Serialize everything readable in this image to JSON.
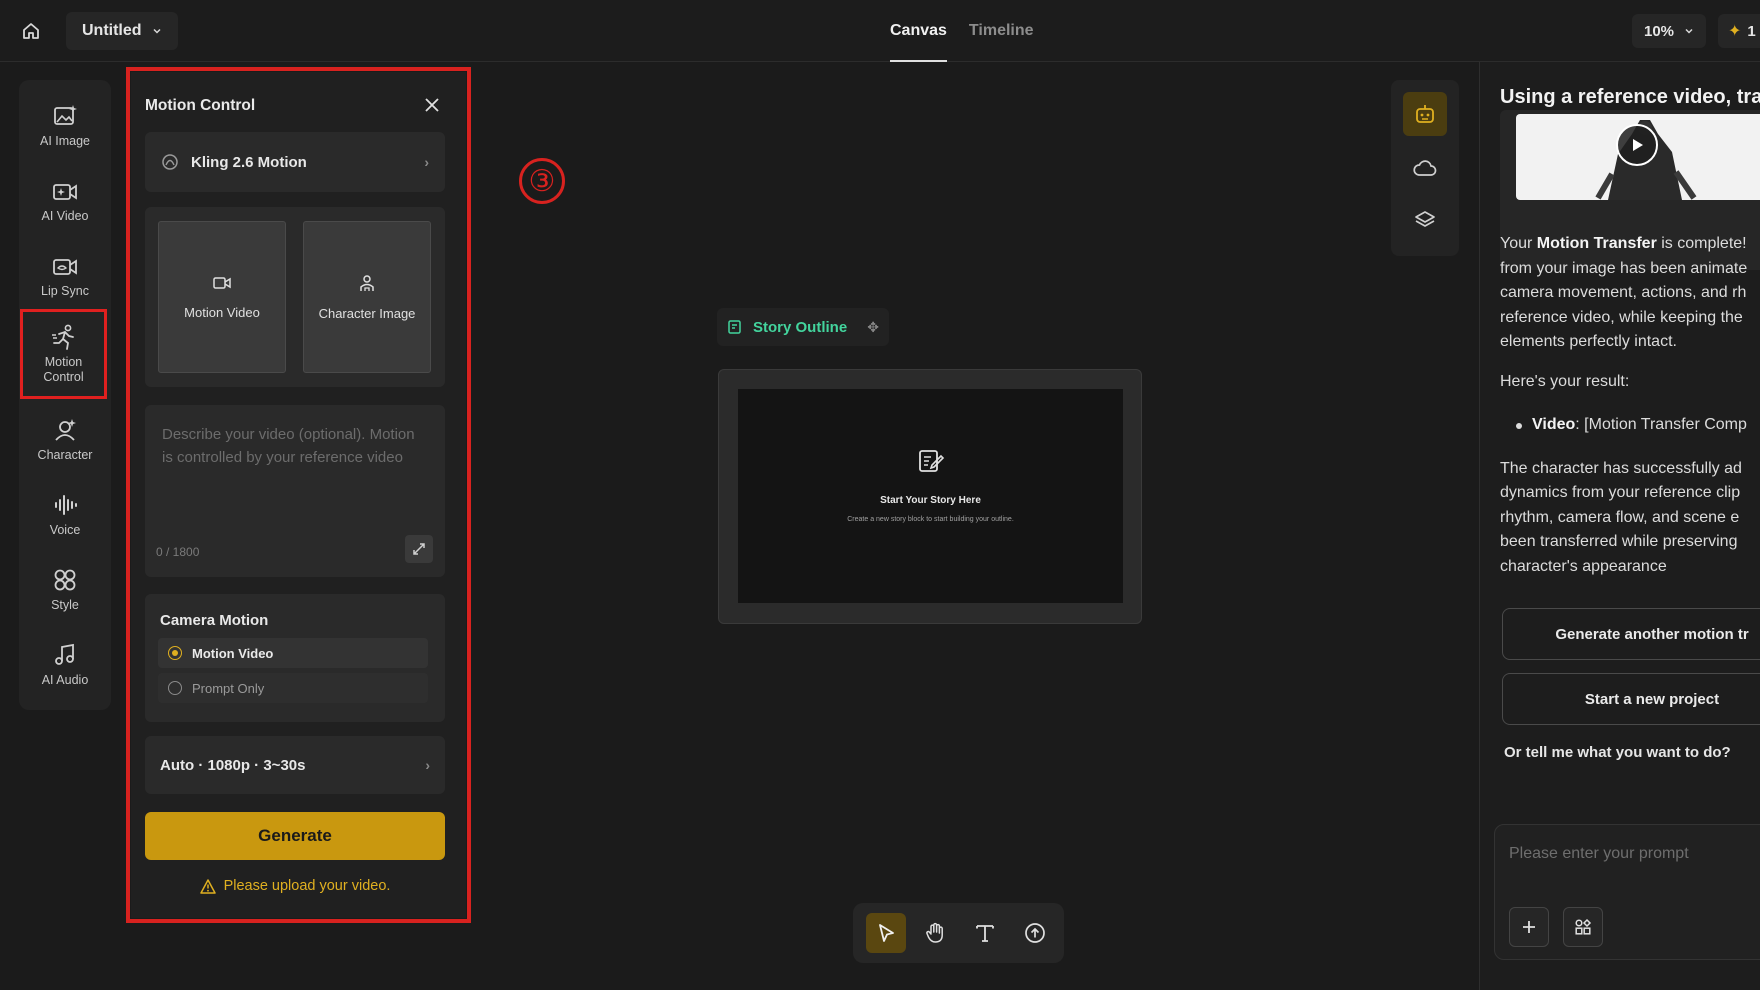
{
  "topbar": {
    "title": "Untitled",
    "tabs": [
      "Canvas",
      "Timeline"
    ],
    "zoom": "10%",
    "credits": "1"
  },
  "left_tools": [
    {
      "label": "AI Image",
      "icon": "image-sparkle-icon"
    },
    {
      "label": "AI Video",
      "icon": "video-sparkle-icon"
    },
    {
      "label": "Lip Sync",
      "icon": "lip-sync-icon"
    },
    {
      "label": "Motion Control",
      "icon": "running-figure-icon",
      "selected": true
    },
    {
      "label": "Character",
      "icon": "character-icon"
    },
    {
      "label": "Voice",
      "icon": "waveform-icon"
    },
    {
      "label": "Style",
      "icon": "style-grid-icon"
    },
    {
      "label": "AI Audio",
      "icon": "music-note-icon"
    }
  ],
  "motion_panel": {
    "title": "Motion Control",
    "model": "Kling 2.6 Motion",
    "upload_video_label": "Motion Video",
    "upload_character_label": "Character Image",
    "prompt_placeholder": "Describe your video (optional). Motion is controlled by your reference video",
    "prompt_count": "0 / 1800",
    "camera_motion_title": "Camera Motion",
    "camera_options": [
      "Motion Video",
      "Prompt Only"
    ],
    "camera_selected": "Motion Video",
    "settings": "Auto · 1080p · 3~30s",
    "generate_label": "Generate",
    "warning": "Please upload your video."
  },
  "annotation": {
    "step_marker": "③",
    "accent": "#d8221f"
  },
  "story": {
    "label": "Story Outline",
    "heading": "Start Your Story Here",
    "subtext": "Create a new story block to start building your outline."
  },
  "chat": {
    "heading": "Using a reference video, tra",
    "p1_prefix": "Your ",
    "p1_bold": "Motion Transfer",
    "p1_lines": [
      " is complete!",
      "from your image has been animate",
      "camera movement, actions, and rh",
      "reference video, while keeping the",
      "elements perfectly intact."
    ],
    "p2": "Here's your result:",
    "list_bold": "Video",
    "list_rest": ": [Motion Transfer Comp",
    "p3_lines": [
      "The character has successfully ad",
      "dynamics from your reference clip",
      "rhythm, camera flow, and scene e",
      "been transferred while preserving",
      "character's appearance"
    ],
    "action1": "Generate another motion tr",
    "action2": "Start a new project",
    "ask": "Or tell me what you want to do?",
    "input_placeholder": "Please enter your prompt"
  },
  "colors": {
    "accent_gold": "#c9980f",
    "story_green": "#43d49d",
    "warning_yellow": "#e0b020"
  }
}
